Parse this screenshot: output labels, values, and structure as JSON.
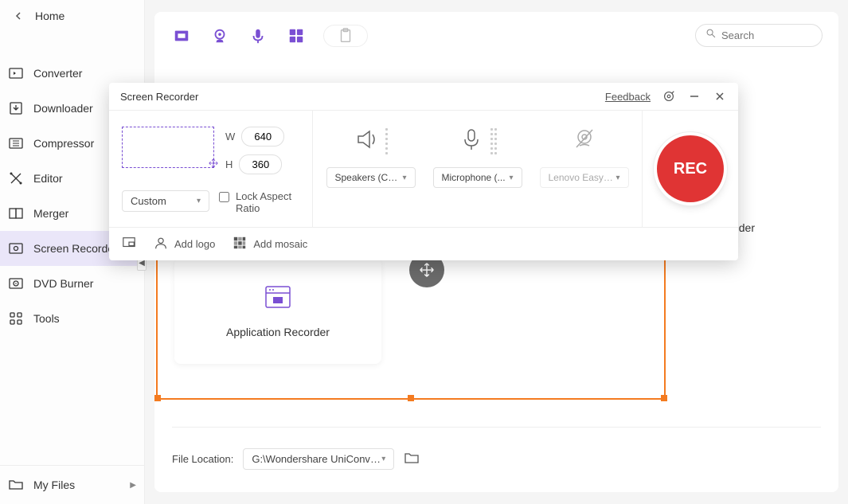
{
  "sidebar": {
    "home": "Home",
    "items": [
      {
        "label": "Converter"
      },
      {
        "label": "Downloader"
      },
      {
        "label": "Compressor"
      },
      {
        "label": "Editor"
      },
      {
        "label": "Merger"
      },
      {
        "label": "Screen Recorder"
      },
      {
        "label": "DVD Burner"
      },
      {
        "label": "Tools"
      }
    ],
    "my_files": "My Files"
  },
  "search": {
    "placeholder": "Search"
  },
  "main": {
    "recorder_label": "der",
    "app_recorder": "Application Recorder",
    "file_location_label": "File Location:",
    "file_location_value": "G:\\Wondershare UniConverter"
  },
  "dialog": {
    "title": "Screen Recorder",
    "feedback": "Feedback",
    "width_label": "W",
    "height_label": "H",
    "width_value": "640",
    "height_value": "360",
    "region_mode": "Custom",
    "lock_aspect": "Lock Aspect Ratio",
    "speaker_device": "Speakers (Con...",
    "mic_device": "Microphone (...",
    "cam_device": "Lenovo EasyC...",
    "rec_label": "REC",
    "add_logo": "Add logo",
    "add_mosaic": "Add mosaic"
  }
}
